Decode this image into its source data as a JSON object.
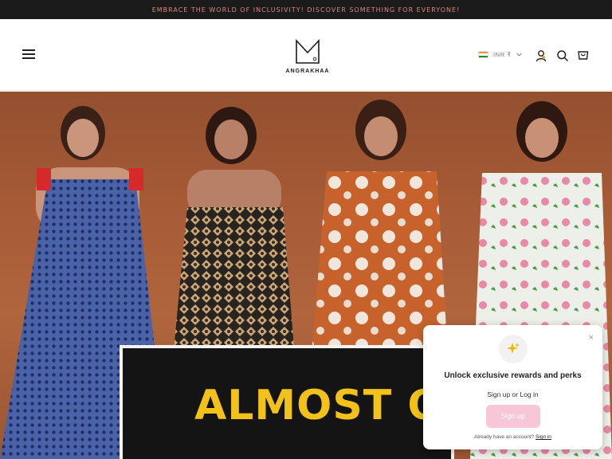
{
  "announcement": {
    "text": "EMBRACE THE WORLD OF INCLUSIVITY! DISCOVER SOMETHING FOR EVERYONE!"
  },
  "header": {
    "logo_text": "ANGRAKHAA",
    "currency": "INR ₹",
    "icons": [
      "menu-icon",
      "india-flag-icon",
      "chevron-down-icon",
      "account-icon",
      "search-icon",
      "cart-icon"
    ]
  },
  "hero": {
    "promo_text": "ALMOST OUT"
  },
  "popup": {
    "title": "Unlock exclusive rewards and perks",
    "subtitle": "Sign up or Log in",
    "button_label": "Sign up",
    "footer_text": "Already have an account?",
    "footer_link": "Sign in",
    "close_symbol": "×"
  },
  "colors": {
    "announcement_bg": "#1b1b1b",
    "announcement_text": "#d68a7a",
    "hero_bg": "#a65a36",
    "promo_yellow": "#f2c21a",
    "signup_pink": "#f7c7d7"
  }
}
